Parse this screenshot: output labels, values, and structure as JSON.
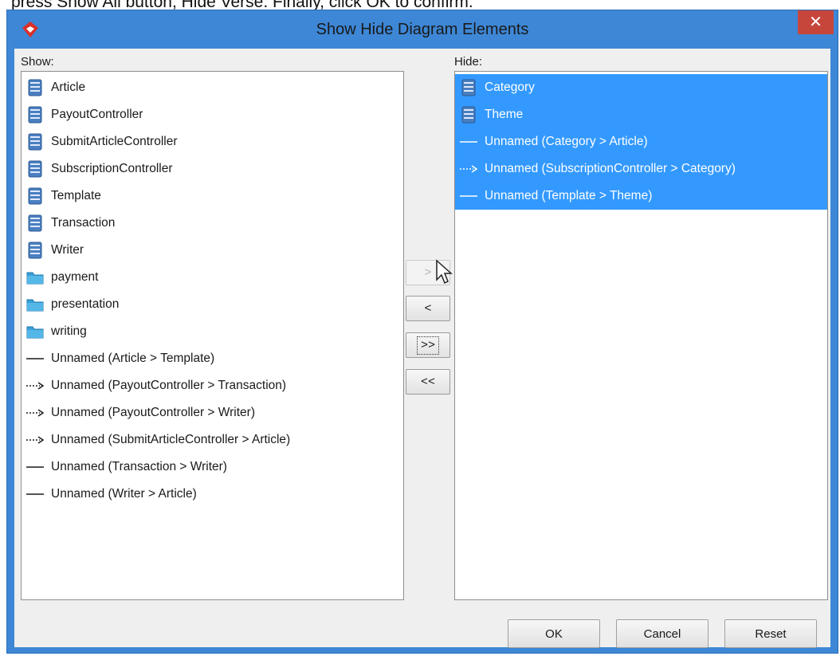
{
  "background": {
    "instruction_text": "press Show All button, Hide Verse. Finally, click OK to confirm."
  },
  "dialog": {
    "title": "Show Hide Diagram Elements",
    "close_label": "✕",
    "colors": {
      "frame": "#3d87d6",
      "close": "#c7463c",
      "selection": "#3399ff"
    }
  },
  "show": {
    "label": "Show:",
    "items": [
      {
        "icon": "class-icon",
        "label": "Article"
      },
      {
        "icon": "class-icon",
        "label": "PayoutController"
      },
      {
        "icon": "class-icon",
        "label": "SubmitArticleController"
      },
      {
        "icon": "class-icon",
        "label": "SubscriptionController"
      },
      {
        "icon": "class-icon",
        "label": "Template"
      },
      {
        "icon": "class-icon",
        "label": "Transaction"
      },
      {
        "icon": "class-icon",
        "label": "Writer"
      },
      {
        "icon": "package-icon",
        "label": "payment"
      },
      {
        "icon": "package-icon",
        "label": "presentation"
      },
      {
        "icon": "package-icon",
        "label": "writing"
      },
      {
        "icon": "association-icon",
        "label": "Unnamed (Article > Template)"
      },
      {
        "icon": "dependency-icon",
        "label": "Unnamed (PayoutController > Transaction)"
      },
      {
        "icon": "dependency-icon",
        "label": "Unnamed (PayoutController > Writer)"
      },
      {
        "icon": "dependency-icon",
        "label": "Unnamed (SubmitArticleController > Article)"
      },
      {
        "icon": "association-icon",
        "label": "Unnamed (Transaction > Writer)"
      },
      {
        "icon": "association-icon",
        "label": "Unnamed (Writer > Article)"
      }
    ]
  },
  "hide": {
    "label": "Hide:",
    "items": [
      {
        "icon": "class-icon",
        "label": "Category"
      },
      {
        "icon": "class-icon",
        "label": "Theme"
      },
      {
        "icon": "association-icon",
        "label": "Unnamed (Category > Article)"
      },
      {
        "icon": "dependency-icon",
        "label": "Unnamed (SubscriptionController > Category)"
      },
      {
        "icon": "association-icon",
        "label": "Unnamed (Template > Theme)"
      }
    ]
  },
  "transfer": {
    "add": ">",
    "remove": "<",
    "add_all": ">>",
    "remove_all": "<<"
  },
  "footer": {
    "ok": "OK",
    "cancel": "Cancel",
    "reset": "Reset"
  }
}
